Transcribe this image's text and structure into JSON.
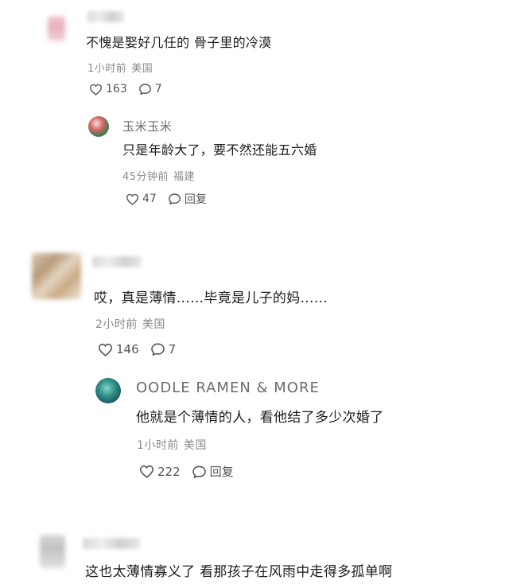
{
  "comments": [
    {
      "text": "不愧是娶好几任的 骨子里的冷漠",
      "time": "1小时前",
      "location": "美国",
      "likes": "163",
      "replies": "7",
      "reply": {
        "username": "玉米玉米",
        "text": "只是年龄大了，要不然还能五六婚",
        "time": "45分钟前",
        "location": "福建",
        "likes": "47",
        "reply_label": "回复"
      }
    },
    {
      "text": "哎，真是薄情……毕竟是儿子的妈……",
      "time": "2小时前",
      "location": "美国",
      "likes": "146",
      "replies": "7",
      "reply": {
        "username": "OODLE RAMEN & MORE",
        "text": "他就是个薄情的人，看他结了多少次婚了",
        "time": "1小时前",
        "location": "美国",
        "likes": "222",
        "reply_label": "回复"
      }
    },
    {
      "text": "这也太薄情寡义了 看那孩子在风雨中走得多孤单啊"
    }
  ],
  "icons": {
    "like": "heart-icon",
    "comment": "speech-bubble-icon"
  }
}
